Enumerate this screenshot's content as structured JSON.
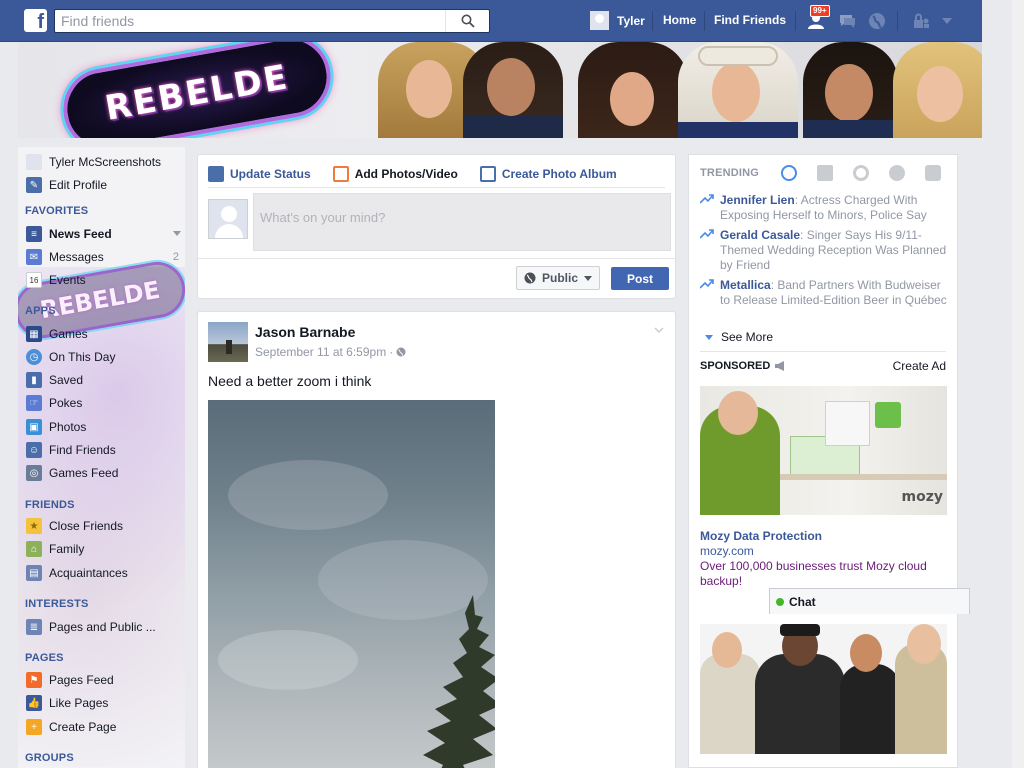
{
  "topbar": {
    "logo": "f",
    "search_placeholder": "Find friends",
    "user_name": "Tyler",
    "home": "Home",
    "find_friends": "Find Friends",
    "notif_badge": "99+",
    "brand_color": "#3b5998"
  },
  "banner": {
    "logo_text": "REBELDE"
  },
  "left": {
    "user": "Tyler McScreenshots",
    "edit_profile": "Edit Profile",
    "favorites_head": "FAVORITES",
    "news_feed": "News Feed",
    "messages": "Messages",
    "messages_count": "2",
    "events": "Events",
    "events_date": "16",
    "apps_head": "APPS",
    "games": "Games",
    "on_this_day": "On This Day",
    "saved": "Saved",
    "pokes": "Pokes",
    "photos": "Photos",
    "find_friends": "Find Friends",
    "games_feed": "Games Feed",
    "friends_head": "FRIENDS",
    "close_friends": "Close Friends",
    "family": "Family",
    "acquaintances": "Acquaintances",
    "interests_head": "INTERESTS",
    "pages_public": "Pages and Public ...",
    "pages_head": "PAGES",
    "pages_feed": "Pages Feed",
    "like_pages": "Like Pages",
    "create_page": "Create Page",
    "groups_head": "GROUPS",
    "overlay_logo": "REBELDE"
  },
  "composer": {
    "tab_status": "Update Status",
    "tab_photos": "Add Photos/Video",
    "tab_album": "Create Photo Album",
    "placeholder": "What's on your mind?",
    "privacy": "Public",
    "post": "Post"
  },
  "story": {
    "author": "Jason Barnabe",
    "time": "September 11 at 6:59pm",
    "text": "Need a better zoom i think"
  },
  "right": {
    "trending_head": "TRENDING",
    "trends": [
      {
        "name": "Jennifer Lien",
        "desc": ": Actress Charged With Exposing Herself to Minors, Police Say"
      },
      {
        "name": "Gerald Casale",
        "desc": ": Singer Says His 9/11-Themed Wedding Reception Was Planned by Friend"
      },
      {
        "name": "Metallica",
        "desc": ": Band Partners With Budweiser to Release Limited-Edition Beer in Québec"
      }
    ],
    "see_more": "See More",
    "sponsored": "SPONSORED",
    "create_ad": "Create Ad",
    "ad1": {
      "brand_mark": "mozy",
      "title": "Mozy Data Protection",
      "url": "mozy.com",
      "desc": "Over 100,000 businesses trust Mozy cloud backup!"
    }
  },
  "chat": {
    "label": "Chat"
  }
}
